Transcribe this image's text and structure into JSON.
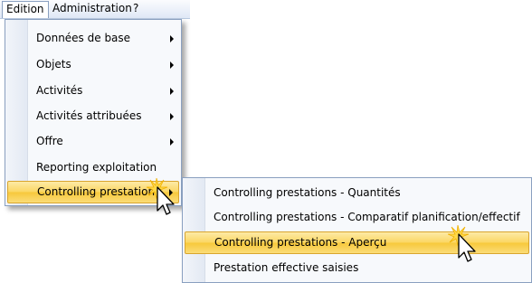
{
  "menubar": {
    "items": [
      {
        "label": "Edition",
        "active": true
      },
      {
        "label": "Administration",
        "active": false
      },
      {
        "label": "?",
        "active": false
      }
    ]
  },
  "main_menu": {
    "items": [
      {
        "label": "Données de base",
        "has_submenu": true,
        "highlighted": false
      },
      {
        "label": "Objets",
        "has_submenu": true,
        "highlighted": false
      },
      {
        "label": "Activités",
        "has_submenu": true,
        "highlighted": false
      },
      {
        "label": "Activités attribuées",
        "has_submenu": true,
        "highlighted": false
      },
      {
        "label": "Offre",
        "has_submenu": true,
        "highlighted": false
      },
      {
        "label": "Reporting exploitation",
        "has_submenu": false,
        "highlighted": false
      },
      {
        "label": "Controlling prestations",
        "has_submenu": true,
        "highlighted": true
      }
    ]
  },
  "sub_menu": {
    "items": [
      {
        "label": "Controlling prestations - Quantités",
        "highlighted": false
      },
      {
        "label": "Controlling prestations - Comparatif planification/effectif",
        "highlighted": false
      },
      {
        "label": "Controlling prestations - Aperçu",
        "highlighted": true
      },
      {
        "label": "Prestation effective saisies",
        "highlighted": false
      }
    ]
  },
  "colors": {
    "highlight": "#fbd661",
    "highlight_border": "#d9a52e",
    "menu_border": "#8aa0c0",
    "menu_background": "#f7f9fc"
  },
  "icons": {
    "cursor": "arrow-cursor-icon",
    "click": "click-sparkle-icon",
    "submenu": "chevron-right-icon"
  }
}
